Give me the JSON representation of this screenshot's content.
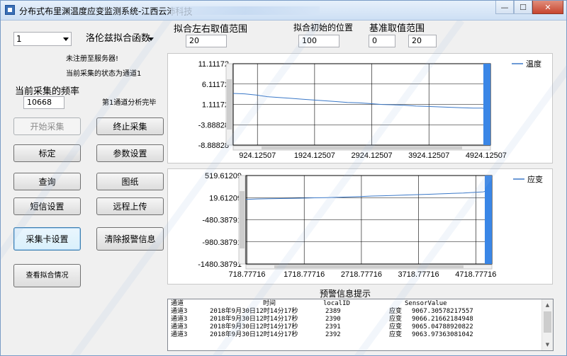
{
  "window": {
    "title": "分布式布里渊温度应变监测系统-江西云沛科技",
    "buttons": {
      "minimize": "—",
      "maximize": "☐",
      "close": "✕"
    }
  },
  "left": {
    "channel_combo": "1",
    "fit_func_combo": "洛伦兹拟合函数",
    "status_not_registered": "未注册至服务器!",
    "status_channel": "当前采集的状态为通道1",
    "freq_label": "当前采集的频率",
    "freq_value": "10668",
    "channel_done": "第1通道分析完毕",
    "buttons": {
      "start": "开始采集",
      "stop": "终止采集",
      "calibrate": "标定",
      "params": "参数设置",
      "query": "查询",
      "drawing": "图纸",
      "sms": "短信设置",
      "upload": "远程上传",
      "card": "采集卡设置",
      "clear_alarm": "清除报警信息",
      "view_fit": "查看拟合情况"
    }
  },
  "top": {
    "fit_range_label": "拟合左右取值范围",
    "fit_range_value": "20",
    "fit_start_label": "拟合初始的位置",
    "fit_start_value": "100",
    "base_range_label": "基准取值范围",
    "base_min": "0",
    "base_max": "20"
  },
  "chart_data": [
    {
      "type": "line",
      "y_ticks": [
        "11.11172",
        "6.11172",
        "1.11172",
        "-3.88828",
        "-8.88828"
      ],
      "y_tick_values": [
        11.11172,
        6.11172,
        1.11172,
        -3.88828,
        -8.88828
      ],
      "x_ticks": [
        "924.12507",
        "1924.12507",
        "2924.12507",
        "3924.12507",
        "4924.12507"
      ],
      "x_tick_values": [
        924.12507,
        1924.12507,
        2924.12507,
        3924.12507,
        4924.12507
      ],
      "xlim": [
        500,
        5000
      ],
      "ylim": [
        -8.88828,
        11.11172
      ],
      "grid": true,
      "legend_position": "right",
      "series": [
        {
          "name": "温度",
          "color": "#3a78c8",
          "x": [
            500,
            700,
            900,
            1100,
            1300,
            1500,
            1700,
            1900,
            2100,
            2300,
            2500,
            2700,
            2900,
            3100,
            3300,
            3500,
            3700,
            3900,
            4100,
            4300,
            4500,
            4700,
            4850,
            4900,
            4930
          ],
          "y": [
            3.8,
            3.7,
            3.4,
            3.0,
            2.8,
            2.6,
            2.4,
            2.2,
            2.0,
            1.8,
            1.6,
            1.5,
            1.3,
            1.1,
            1.0,
            0.9,
            0.7,
            0.6,
            0.5,
            0.4,
            0.3,
            0.2,
            0.2,
            0.1,
            -7.5
          ]
        }
      ]
    },
    {
      "type": "line",
      "y_ticks": [
        "519.61209",
        "19.61209",
        "-480.38791",
        "-980.38791",
        "-1480.38791"
      ],
      "y_tick_values": [
        519.61209,
        19.61209,
        -480.38791,
        -980.38791,
        -1480.38791
      ],
      "x_ticks": [
        "718.77716",
        "1718.77716",
        "2718.77716",
        "3718.77716",
        "4718.77716"
      ],
      "x_tick_values": [
        718.77716,
        1718.77716,
        2718.77716,
        3718.77716,
        4718.77716
      ],
      "xlim": [
        700,
        5000
      ],
      "ylim": [
        -1480.38791,
        519.61209
      ],
      "grid": true,
      "legend_position": "right",
      "series": [
        {
          "name": "应变",
          "color": "#3a78c8",
          "x": [
            700,
            900,
            1100,
            1300,
            1500,
            1700,
            1900,
            2100,
            2300,
            2500,
            2700,
            2900,
            3100,
            3300,
            3500,
            3700,
            3900,
            4100,
            4300,
            4500,
            4700,
            4850,
            4900,
            4930
          ],
          "y": [
            -20,
            -10,
            -5,
            0,
            5,
            10,
            15,
            20,
            28,
            35,
            45,
            55,
            62,
            70,
            80,
            88,
            95,
            105,
            115,
            125,
            140,
            150,
            170,
            300
          ]
        }
      ]
    }
  ],
  "alarm": {
    "title": "预警信息提示",
    "headers": [
      "通道",
      "时间",
      "localID",
      "SensorValue"
    ],
    "rows": [
      {
        "channel": "通道3",
        "time": "2018年9月30日12时14分17秒",
        "local_id": "2389",
        "type": "应变",
        "value": "9067.30578217557"
      },
      {
        "channel": "通道3",
        "time": "2018年9月30日12时14分17秒",
        "local_id": "2390",
        "type": "应变",
        "value": "9066.21662184948"
      },
      {
        "channel": "通道3",
        "time": "2018年9月30日12时14分17秒",
        "local_id": "2391",
        "type": "应变",
        "value": "9065.04788920822"
      },
      {
        "channel": "通道3",
        "time": "2018年9月30日12时14分17秒",
        "local_id": "2392",
        "type": "应变",
        "value": "9063.97363081042"
      }
    ]
  },
  "colors": {
    "bar": "#3a86e6",
    "line": "#3a78c8"
  },
  "icons": {
    "app": "app-icon",
    "scroll_up": "scroll-up-icon",
    "scroll_down": "scroll-down-icon"
  }
}
